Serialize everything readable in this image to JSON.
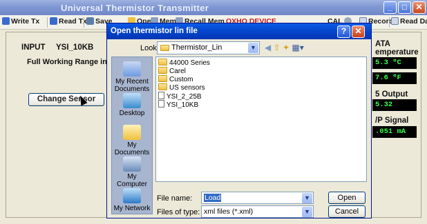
{
  "app": {
    "title": "Universal Thermistor Transmitter"
  },
  "toolbar": {
    "write_tx": "Write Tx",
    "read_tx": "Read Tx",
    "save": "Save",
    "open": "Open",
    "mem": "Mem",
    "recall_mem": "Recall Mem",
    "device": "OXHO DEVICE",
    "cal": "CAL",
    "record": "Record",
    "read_data": "Read Data"
  },
  "main": {
    "input_label": "INPUT",
    "input_value": "YSI_10KB",
    "range_label": "Full Working Range in '(",
    "change_sensor": "Change Sensor",
    "data_header": "ATA",
    "temperature_label": "emperature",
    "temp_c": "5.3 ºC",
    "temp_f": "7.6 ºF",
    "output_label": "5 Output",
    "output_value": "5.32",
    "signal_label": "/P Signal",
    "signal_value": ".051 mA"
  },
  "dialog": {
    "title": "Open thermistor lin file",
    "look_in_label": "Look in:",
    "look_in_value": "Thermistor_Lin",
    "places": [
      "My Recent Documents",
      "Desktop",
      "My Documents",
      "My Computer",
      "My Network"
    ],
    "folders": [
      "44000 Series",
      "Carel",
      "Custom",
      "US sensors"
    ],
    "files": [
      "YSI_2_25B",
      "YSI_10KB"
    ],
    "file_name_label": "File name:",
    "file_name_value": "Load",
    "file_type_label": "Files of type:",
    "file_type_value": "xml files (*.xml)",
    "open_button": "Open",
    "cancel_button": "Cancel"
  }
}
